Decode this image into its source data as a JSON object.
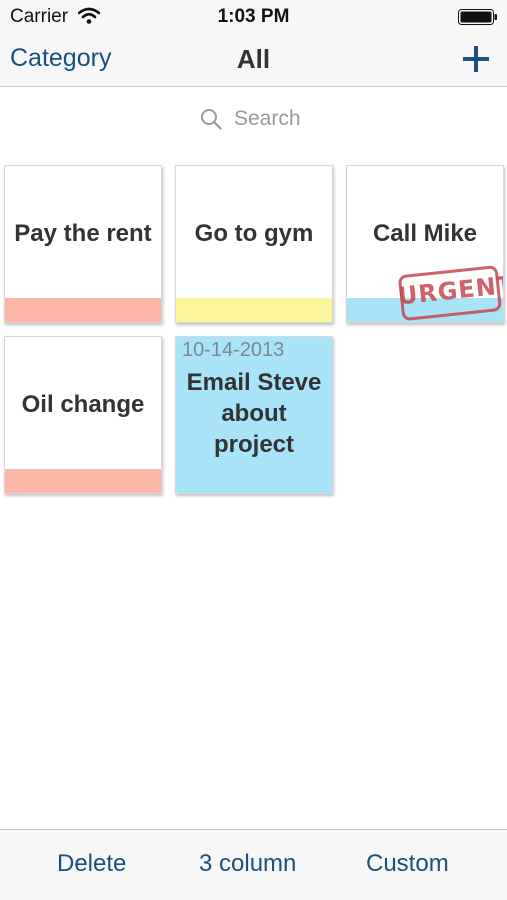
{
  "status_bar": {
    "carrier": "Carrier",
    "time": "1:03 PM"
  },
  "nav": {
    "left_label": "Category",
    "title": "All",
    "add_icon": "plus-icon"
  },
  "search": {
    "placeholder": "Search",
    "icon": "search-icon"
  },
  "notes": [
    {
      "title": "Pay the rent",
      "strip_color": "#fdb7a8"
    },
    {
      "title": "Go to gym",
      "strip_color": "#fbf59b"
    },
    {
      "title": "Call Mike",
      "strip_color": "#a9e3f7",
      "stamp": "URGENT"
    },
    {
      "title": "Oil change",
      "strip_color": "#fdb7a8"
    },
    {
      "title": "Email Steve about project",
      "date": "10-14-2013",
      "background": "#a9e3f7"
    }
  ],
  "toolbar": {
    "delete_label": "Delete",
    "columns_label": "3 column",
    "custom_label": "Custom"
  },
  "colors": {
    "accent": "#1b4f80",
    "stamp_red": "#c8474f",
    "bar_background": "#f7f7f7"
  }
}
